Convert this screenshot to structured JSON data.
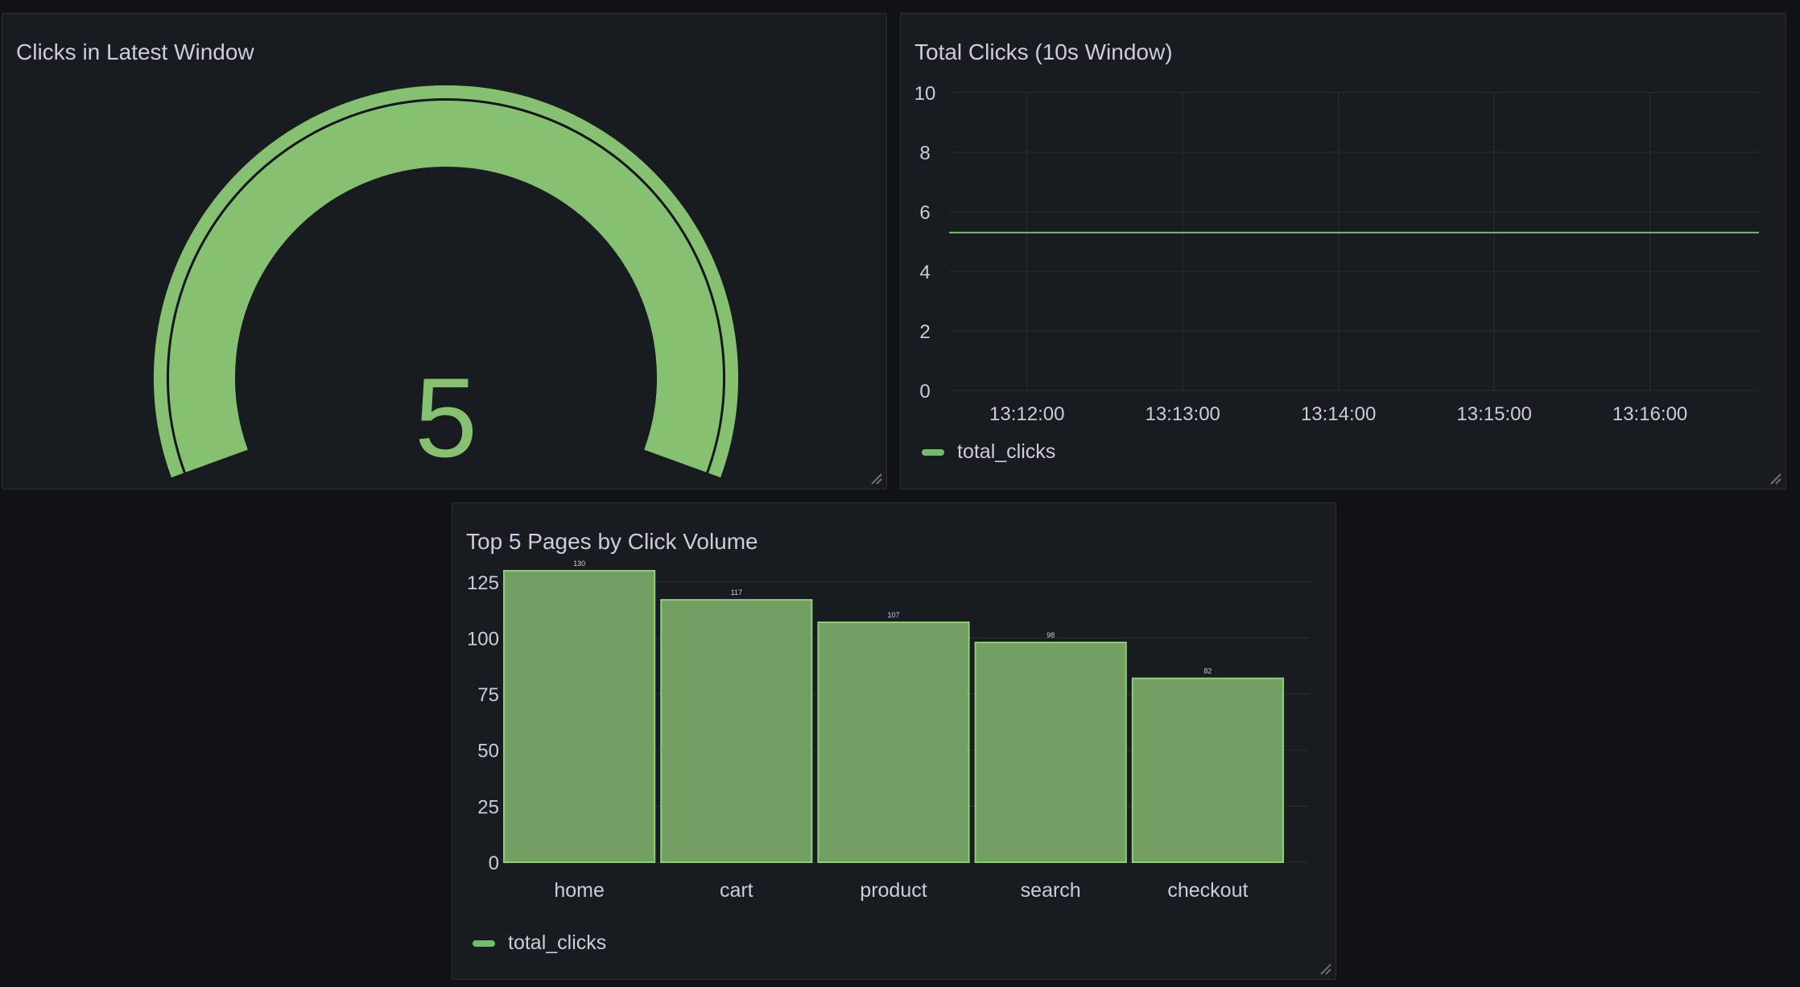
{
  "colors": {
    "series": "#73bf69",
    "gauge": "#85c170",
    "bar_fill": "#73a062",
    "bar_stroke": "#8ccf79",
    "grid": "#2a2d33",
    "axis_text": "#ccccdc"
  },
  "panels": {
    "gauge": {
      "title": "Clicks in Latest Window"
    },
    "timeseries": {
      "title": "Total Clicks (10s Window)",
      "legend": "total_clicks"
    },
    "bars": {
      "title": "Top 5 Pages by Click Volume",
      "legend": "total_clicks"
    }
  },
  "chart_data": [
    {
      "type": "gauge",
      "value": 5,
      "display_value": "5",
      "max": 10
    },
    {
      "type": "line",
      "x": [
        "13:11:30",
        "13:12:00",
        "13:13:00",
        "13:14:00",
        "13:15:00",
        "13:16:00",
        "13:16:42"
      ],
      "series": [
        {
          "name": "total_clicks",
          "values": [
            5.3,
            5.3,
            5.3,
            5.3,
            5.3,
            5.3,
            5.3
          ]
        }
      ],
      "xticks": [
        "13:12:00",
        "13:13:00",
        "13:14:00",
        "13:15:00",
        "13:16:00"
      ],
      "yticks": [
        0,
        2,
        4,
        6,
        8,
        10
      ],
      "ylim": [
        0,
        10
      ],
      "grid": true,
      "legend_position": "bottom-left"
    },
    {
      "type": "bar",
      "categories": [
        "home",
        "cart",
        "product",
        "search",
        "checkout"
      ],
      "series": [
        {
          "name": "total_clicks",
          "values": [
            130,
            117,
            107,
            98,
            82
          ]
        }
      ],
      "value_labels": [
        "130",
        "117",
        "107",
        "98",
        "82"
      ],
      "yticks": [
        0,
        25,
        50,
        75,
        100,
        125
      ],
      "ylim": [
        0,
        135
      ],
      "grid": true,
      "legend_position": "bottom-left"
    }
  ]
}
